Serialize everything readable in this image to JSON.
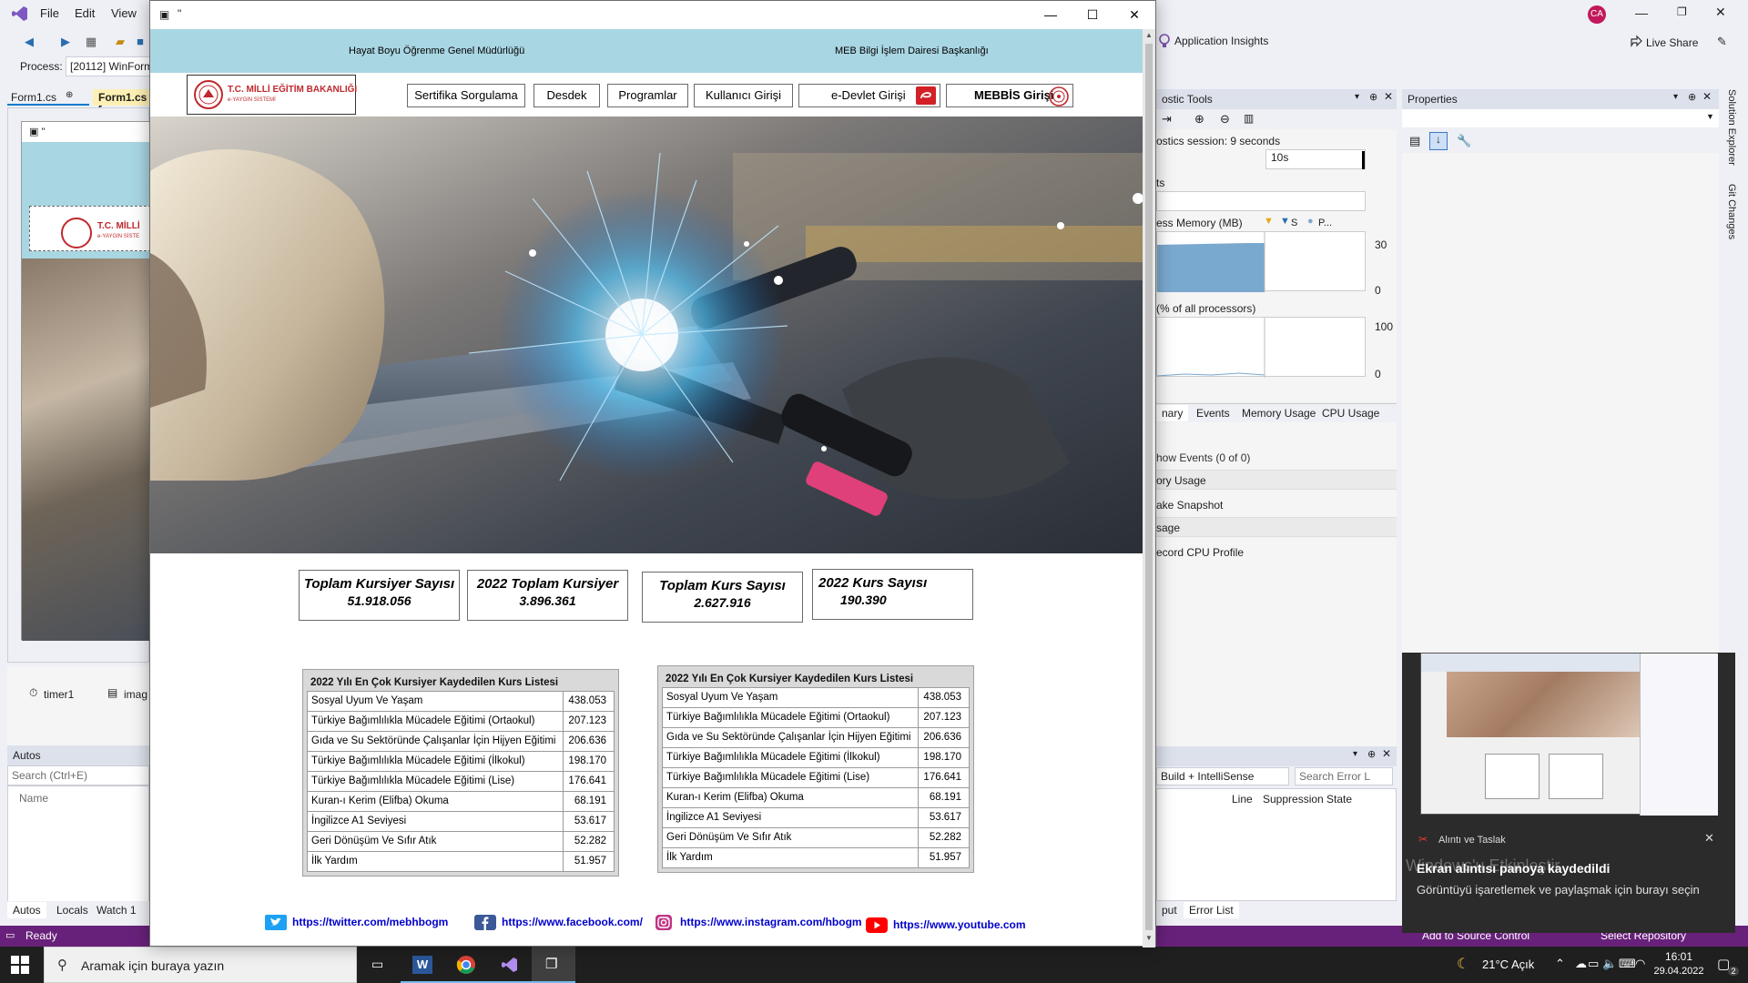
{
  "vs": {
    "menu": [
      "File",
      "Edit",
      "View"
    ],
    "process_label": "Process:",
    "process_value": "[20112] WinForm",
    "tabs": [
      "Form1.cs",
      "Form1.cs ["
    ],
    "designer_logo_text": "T.C. MİLLİ",
    "designer_logo_sub": "e-YAYGIN SİSTE",
    "components": [
      "timer1",
      "imag"
    ],
    "autos_title": "Autos",
    "autos_search_placeholder": "Search (Ctrl+E)",
    "autos_column": "Name",
    "bottom_tabs": [
      "Autos",
      "Locals",
      "Watch 1"
    ],
    "status": "Ready",
    "account_initials": "CA",
    "app_insights": "Application Insights",
    "live_share": "Live Share",
    "diag": {
      "title": "ostic Tools",
      "session": "ostics session: 9 seconds",
      "timeline_tick": "10s",
      "events_label": "ts",
      "memory_label": "ess Memory (MB)",
      "memory_legend": [
        "S",
        "P..."
      ],
      "memory_max": "30",
      "memory_min": "0",
      "cpu_label": "(% of all processors)",
      "cpu_max": "100",
      "cpu_min": "0",
      "tabs": [
        "nary",
        "Events",
        "Memory Usage",
        "CPU Usage"
      ],
      "events_line": "how Events (0 of 0)",
      "memory_section": "ory Usage",
      "snapshot": "ake Snapshot",
      "cpu_section": "sage",
      "record_cpu": "ecord CPU Profile"
    },
    "properties_title": "Properties",
    "side_tabs": [
      "Solution Explorer",
      "Git Changes"
    ],
    "error_list": {
      "filter": "Build + IntelliSense",
      "search_placeholder": "Search Error L",
      "columns": [
        "Line",
        "Suppression State"
      ],
      "tabs": [
        "put",
        "Error List"
      ]
    },
    "source_control": [
      "Add to Source Control",
      "Select Repository"
    ]
  },
  "taskbar": {
    "search_placeholder": "Aramak için buraya yazın",
    "weather": "21°C  Açık",
    "time": "16:01",
    "date": "29.04.2022",
    "notification_count": "2"
  },
  "toast": {
    "app": "Alıntı ve Taslak",
    "title": "Ekran alıntısı panoya kaydedildi",
    "body": "Görüntüyü işaretlemek ve paylaşmak için burayı seçin",
    "watermark": "Windows'u Etkinleştir"
  },
  "app": {
    "window_title": "\"",
    "header_left": "Hayat Boyu Öğrenme Genel Müdürlüğü",
    "header_right": "MEB Bilgi İşlem Dairesi Başkanlığı",
    "logo_title": "T.C. MİLLİ EĞİTİM BAKANLIĞI",
    "logo_sub": "e-YAYGIN SİSTEMİ",
    "nav": [
      "Sertifika Sorgulama",
      "Desdek",
      "Programlar",
      "Kullanıcı Girişi",
      "e-Devlet Girişi",
      "MEBBİS Girişi"
    ],
    "stats": [
      {
        "label": "Toplam Kursiyer Sayısı",
        "value": "51.918.056"
      },
      {
        "label": "2022 Toplam Kursiyer",
        "value": "3.896.361"
      },
      {
        "label": "Toplam Kurs Sayısı",
        "value": "2.627.916"
      },
      {
        "label": "2022 Kurs Sayısı",
        "value": "190.390"
      }
    ],
    "table_title": "2022 Yılı En Çok Kursiyer Kaydedilen Kurs Listesi",
    "courses": [
      {
        "name": "Sosyal Uyum Ve Yaşam",
        "count": "438.053"
      },
      {
        "name": "Türkiye Bağımlılıkla Mücadele Eğitimi (Ortaokul)",
        "count": "207.123"
      },
      {
        "name": "Gıda ve Su Sektöründe Çalışanlar İçin Hijyen Eğitimi",
        "count": "206.636"
      },
      {
        "name": "Türkiye Bağımlılıkla Mücadele Eğitimi (İlkokul)",
        "count": "198.170"
      },
      {
        "name": "Türkiye Bağımlılıkla Mücadele Eğitimi (Lise)",
        "count": "176.641"
      },
      {
        "name": "Kuran-ı Kerim (Elifba) Okuma",
        "count": "68.191"
      },
      {
        "name": "İngilizce A1 Seviyesi",
        "count": "53.617"
      },
      {
        "name": "Geri Dönüşüm Ve Sıfır Atık",
        "count": "52.282"
      },
      {
        "name": "İlk Yardım",
        "count": "51.957"
      }
    ],
    "social": {
      "twitter": "https://twitter.com/mebhbogm",
      "facebook": "https://www.facebook.com/",
      "instagram": "https://www.instagram.com/hbogm",
      "youtube": "https://www.youtube.com"
    }
  },
  "colors": {
    "header_bg": "#a9d6e3",
    "logo_red": "#c0282d",
    "link": "#0000cc",
    "vs_bg": "#eef0f5",
    "vs_purple": "#68217a"
  }
}
